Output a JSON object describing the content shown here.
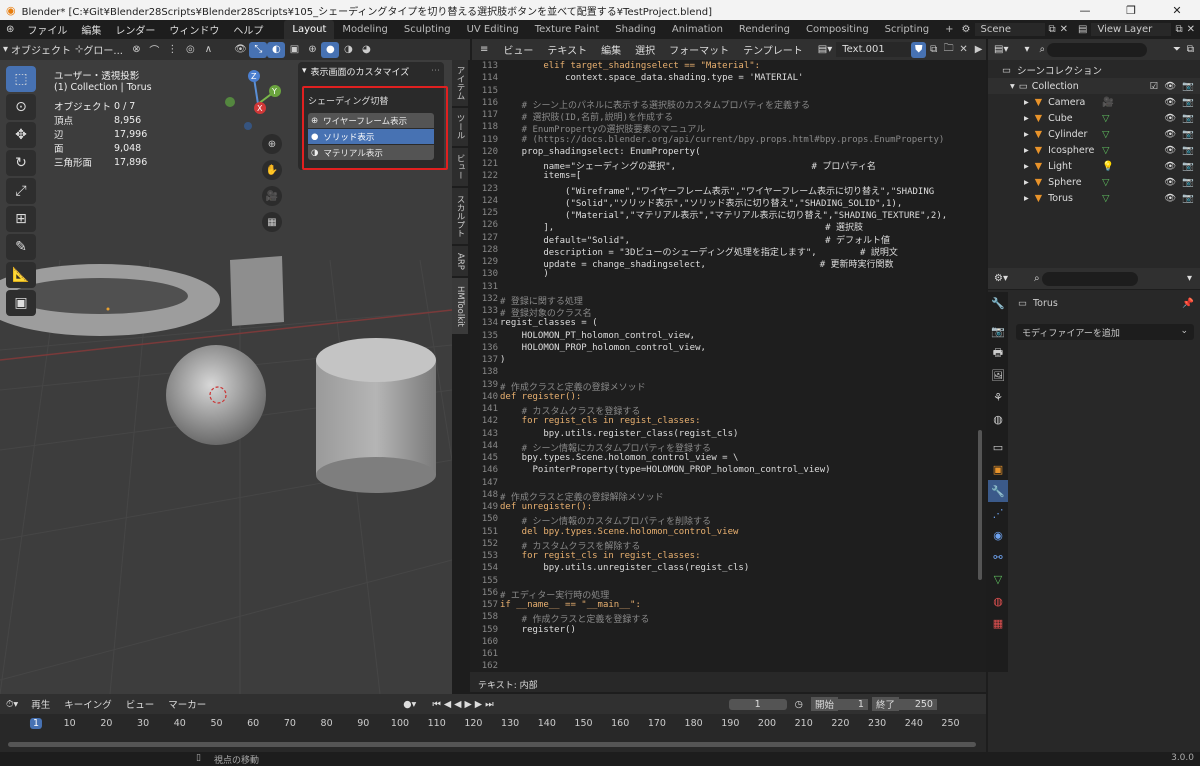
{
  "titlebar": {
    "title": "Blender* [C:¥Git¥Blender28Scripts¥Blender28Scripts¥105_シェーディングタイプを切り替える選択肢ボタンを並べて配置する¥TestProject.blend]",
    "minimize": "—",
    "maximize": "❐",
    "close": "✕"
  },
  "menu": {
    "items": [
      "ファイル",
      "編集",
      "レンダー",
      "ウィンドウ",
      "ヘルプ"
    ]
  },
  "workspaces": [
    "Layout",
    "Modeling",
    "Sculpting",
    "UV Editing",
    "Texture Paint",
    "Shading",
    "Animation",
    "Rendering",
    "Compositing",
    "Scripting"
  ],
  "active_workspace": "Layout",
  "scene_label": "Scene",
  "viewlayer_label": "View Layer",
  "viewport": {
    "mode_label": "オブジェクト",
    "transform_label": "グロー...",
    "view_title": "ユーザー・透視投影",
    "collection_line": "(1) Collection | Torus",
    "stats": [
      {
        "label": "オブジェクト",
        "value": "0 / 7"
      },
      {
        "label": "頂点",
        "value": "8,956"
      },
      {
        "label": "辺",
        "value": "17,996"
      },
      {
        "label": "面",
        "value": "9,048"
      },
      {
        "label": "三角形面",
        "value": "17,896"
      }
    ],
    "gizmo": {
      "z": "Z",
      "y": "Y",
      "x": "X"
    }
  },
  "npanel": {
    "header": "表示画面のカスタマイズ",
    "group_title": "シェーディング切替",
    "options": [
      {
        "label": "ワイヤーフレーム表示",
        "selected": false
      },
      {
        "label": "ソリッド表示",
        "selected": true
      },
      {
        "label": "マテリアル表示",
        "selected": false
      }
    ],
    "highlight_color": "#e02020"
  },
  "sidetabs": [
    "アイテム",
    "ツール",
    "ビュー",
    "スカルプト",
    "ARP",
    "HMToolkit"
  ],
  "editor": {
    "menu": [
      "ビュー",
      "テキスト",
      "編集",
      "選択",
      "フォーマット",
      "テンプレート"
    ],
    "textname": "Text.001",
    "footer": "テキスト: 内部",
    "lines": [
      {
        "n": "113",
        "t": "        elif target_shadingselect == \"Material\":"
      },
      {
        "n": "114",
        "t": "            context.space_data.shading.type = 'MATERIAL'"
      },
      {
        "n": "115",
        "t": ""
      },
      {
        "n": "116",
        "t": "    # シーン上のパネルに表示する選択肢のカスタムプロパティを定義する"
      },
      {
        "n": "117",
        "t": "    # 選択肢(ID,名前,説明)を作成する"
      },
      {
        "n": "118",
        "t": "    # EnumPropertyの選択肢要素のマニュアル"
      },
      {
        "n": "119",
        "t": "    # (https://docs.blender.org/api/current/bpy.props.html#bpy.props.EnumProperty)"
      },
      {
        "n": "120",
        "t": "    prop_shadingselect: EnumProperty("
      },
      {
        "n": "121",
        "t": "        name=\"シェーディングの選択\",                         # プロパティ名"
      },
      {
        "n": "122",
        "t": "        items=["
      },
      {
        "n": "123",
        "t": "            (\"Wireframe\",\"ワイヤーフレーム表示\",\"ワイヤーフレーム表示に切り替え\",\"SHADING"
      },
      {
        "n": "124",
        "t": "            (\"Solid\",\"ソリッド表示\",\"ソリッド表示に切り替え\",\"SHADING_SOLID\",1),"
      },
      {
        "n": "125",
        "t": "            (\"Material\",\"マテリアル表示\",\"マテリアル表示に切り替え\",\"SHADING_TEXTURE\",2),"
      },
      {
        "n": "126",
        "t": "        ],                                                  # 選択肢"
      },
      {
        "n": "127",
        "t": "        default=\"Solid\",                                    # デフォルト値"
      },
      {
        "n": "128",
        "t": "        description = \"3Dビューのシェーディング処理を指定します\",        # 説明文"
      },
      {
        "n": "129",
        "t": "        update = change_shadingselect,                     # 更新時実行関数"
      },
      {
        "n": "130",
        "t": "        )"
      },
      {
        "n": "131",
        "t": ""
      },
      {
        "n": "132",
        "t": "# 登録に関する処理"
      },
      {
        "n": "133",
        "t": "# 登録対象のクラス名"
      },
      {
        "n": "134",
        "t": "regist_classes = ("
      },
      {
        "n": "135",
        "t": "    HOLOMON_PT_holomon_control_view,"
      },
      {
        "n": "136",
        "t": "    HOLOMON_PROP_holomon_control_view,"
      },
      {
        "n": "137",
        "t": ")"
      },
      {
        "n": "138",
        "t": ""
      },
      {
        "n": "139",
        "t": "# 作成クラスと定義の登録メソッド"
      },
      {
        "n": "140",
        "t": "def register():"
      },
      {
        "n": "141",
        "t": "    # カスタムクラスを登録する"
      },
      {
        "n": "142",
        "t": "    for regist_cls in regist_classes:"
      },
      {
        "n": "143",
        "t": "        bpy.utils.register_class(regist_cls)"
      },
      {
        "n": "144",
        "t": "    # シーン情報にカスタムプロパティを登録する"
      },
      {
        "n": "145",
        "t": "    bpy.types.Scene.holomon_control_view = \\"
      },
      {
        "n": "146",
        "t": "      PointerProperty(type=HOLOMON_PROP_holomon_control_view)"
      },
      {
        "n": "147",
        "t": ""
      },
      {
        "n": "148",
        "t": "# 作成クラスと定義の登録解除メソッド"
      },
      {
        "n": "149",
        "t": "def unregister():"
      },
      {
        "n": "150",
        "t": "    # シーン情報のカスタムプロパティを削除する"
      },
      {
        "n": "151",
        "t": "    del bpy.types.Scene.holomon_control_view"
      },
      {
        "n": "152",
        "t": "    # カスタムクラスを解除する"
      },
      {
        "n": "153",
        "t": "    for regist_cls in regist_classes:"
      },
      {
        "n": "154",
        "t": "        bpy.utils.unregister_class(regist_cls)"
      },
      {
        "n": "155",
        "t": ""
      },
      {
        "n": "156",
        "t": "# エディター実行時の処理"
      },
      {
        "n": "157",
        "t": "if __name__ == \"__main__\":"
      },
      {
        "n": "158",
        "t": "    # 作成クラスと定義を登録する"
      },
      {
        "n": "159",
        "t": "    register()"
      },
      {
        "n": "160",
        "t": ""
      },
      {
        "n": "161",
        "t": ""
      },
      {
        "n": "162",
        "t": ""
      }
    ]
  },
  "outliner": {
    "root": "シーンコレクション",
    "collection": "Collection",
    "items": [
      "Camera",
      "Cube",
      "Cylinder",
      "Icosphere",
      "Light",
      "Sphere",
      "Torus"
    ]
  },
  "properties": {
    "object_name": "Torus",
    "add_modifier": "モディファイアーを追加"
  },
  "timeline": {
    "menu": [
      "再生",
      "キーイング",
      "ビュー",
      "マーカー"
    ],
    "current_frame": "1",
    "start_label": "開始",
    "start": "1",
    "end_label": "終了",
    "end": "250",
    "ticks": [
      "1",
      "10",
      "20",
      "30",
      "40",
      "50",
      "60",
      "70",
      "80",
      "90",
      "100",
      "110",
      "120",
      "130",
      "140",
      "150",
      "160",
      "170",
      "180",
      "190",
      "200",
      "210",
      "220",
      "230",
      "240",
      "250"
    ]
  },
  "status": {
    "hint": "視点の移動",
    "version": "3.0.0"
  }
}
